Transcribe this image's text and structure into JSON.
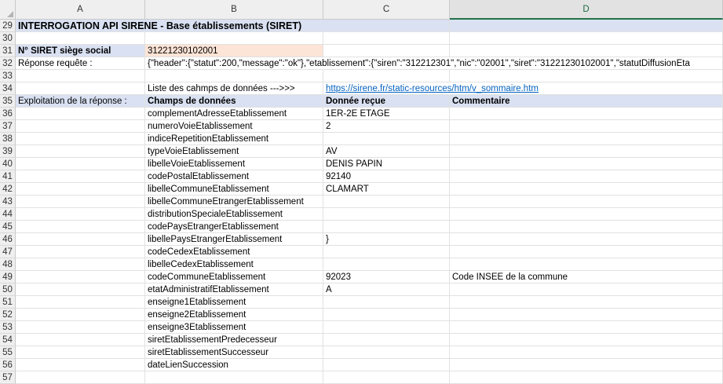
{
  "columns": [
    "A",
    "B",
    "C",
    "D"
  ],
  "selected_column": "D",
  "rows": [
    {
      "n": "29",
      "A": "INTERROGATION API SIRENE - Base établissements (SIRET)",
      "B": "",
      "C": "",
      "D": ""
    },
    {
      "n": "30",
      "A": "",
      "B": "",
      "C": "",
      "D": ""
    },
    {
      "n": "31",
      "A": "N° SIRET siège social",
      "B": "31221230102001",
      "C": "",
      "D": ""
    },
    {
      "n": "32",
      "A": "Réponse requête :",
      "B": "{\"header\":{\"statut\":200,\"message\":\"ok\"},\"etablissement\":{\"siren\":\"312212301\",\"nic\":\"02001\",\"siret\":\"31221230102001\",\"statutDiffusionEta",
      "C": "",
      "D": ""
    },
    {
      "n": "33",
      "A": "",
      "B": "",
      "C": "",
      "D": ""
    },
    {
      "n": "34",
      "A": "",
      "B": "Liste des cahmps de données --->>>",
      "C": "https://sirene.fr/static-resources/htm/v_sommaire.htm",
      "D": ""
    },
    {
      "n": "35",
      "A": "Exploitation de la réponse :",
      "B": "Champs de données",
      "C": "Donnée reçue",
      "D": "Commentaire"
    },
    {
      "n": "36",
      "A": "",
      "B": "complementAdresseEtablissement",
      "C": "1ER-2E ETAGE",
      "D": ""
    },
    {
      "n": "37",
      "A": "",
      "B": "numeroVoieEtablissement",
      "C": "2",
      "D": ""
    },
    {
      "n": "38",
      "A": "",
      "B": "indiceRepetitionEtablissement",
      "C": "",
      "D": ""
    },
    {
      "n": "39",
      "A": "",
      "B": "typeVoieEtablissement",
      "C": "AV",
      "D": ""
    },
    {
      "n": "40",
      "A": "",
      "B": "libelleVoieEtablissement",
      "C": "DENIS PAPIN",
      "D": ""
    },
    {
      "n": "41",
      "A": "",
      "B": "codePostalEtablissement",
      "C": "92140",
      "D": ""
    },
    {
      "n": "42",
      "A": "",
      "B": "libelleCommuneEtablissement",
      "C": "CLAMART",
      "D": ""
    },
    {
      "n": "43",
      "A": "",
      "B": "libelleCommuneEtrangerEtablissement",
      "C": "",
      "D": ""
    },
    {
      "n": "44",
      "A": "",
      "B": "distributionSpecialeEtablissement",
      "C": "",
      "D": ""
    },
    {
      "n": "45",
      "A": "",
      "B": "codePaysEtrangerEtablissement",
      "C": "",
      "D": ""
    },
    {
      "n": "46",
      "A": "",
      "B": "libellePaysEtrangerEtablissement",
      "C": "}",
      "D": ""
    },
    {
      "n": "47",
      "A": "",
      "B": "codeCedexEtablissement",
      "C": "",
      "D": ""
    },
    {
      "n": "48",
      "A": "",
      "B": "libelleCedexEtablissement",
      "C": "",
      "D": ""
    },
    {
      "n": "49",
      "A": "",
      "B": "codeCommuneEtablissement",
      "C": "92023",
      "D": "Code INSEE de la commune"
    },
    {
      "n": "50",
      "A": "",
      "B": "etatAdministratifEtablissement",
      "C": "A",
      "D": ""
    },
    {
      "n": "51",
      "A": "",
      "B": "enseigne1Etablissement",
      "C": "",
      "D": ""
    },
    {
      "n": "52",
      "A": "",
      "B": "enseigne2Etablissement",
      "C": "",
      "D": ""
    },
    {
      "n": "53",
      "A": "",
      "B": "enseigne3Etablissement",
      "C": "",
      "D": ""
    },
    {
      "n": "54",
      "A": "",
      "B": "siretEtablissementPredecesseur",
      "C": "",
      "D": ""
    },
    {
      "n": "55",
      "A": "",
      "B": "siretEtablissementSuccesseur",
      "C": "",
      "D": ""
    },
    {
      "n": "56",
      "A": "",
      "B": "dateLienSuccession",
      "C": "",
      "D": ""
    },
    {
      "n": "57",
      "A": "",
      "B": "",
      "C": "",
      "D": ""
    }
  ],
  "colors": {
    "title_band": "#d9e1f2",
    "siret_value_fill": "#fce4d6",
    "link": "#0563c1",
    "selected_header_accent": "#217346"
  }
}
